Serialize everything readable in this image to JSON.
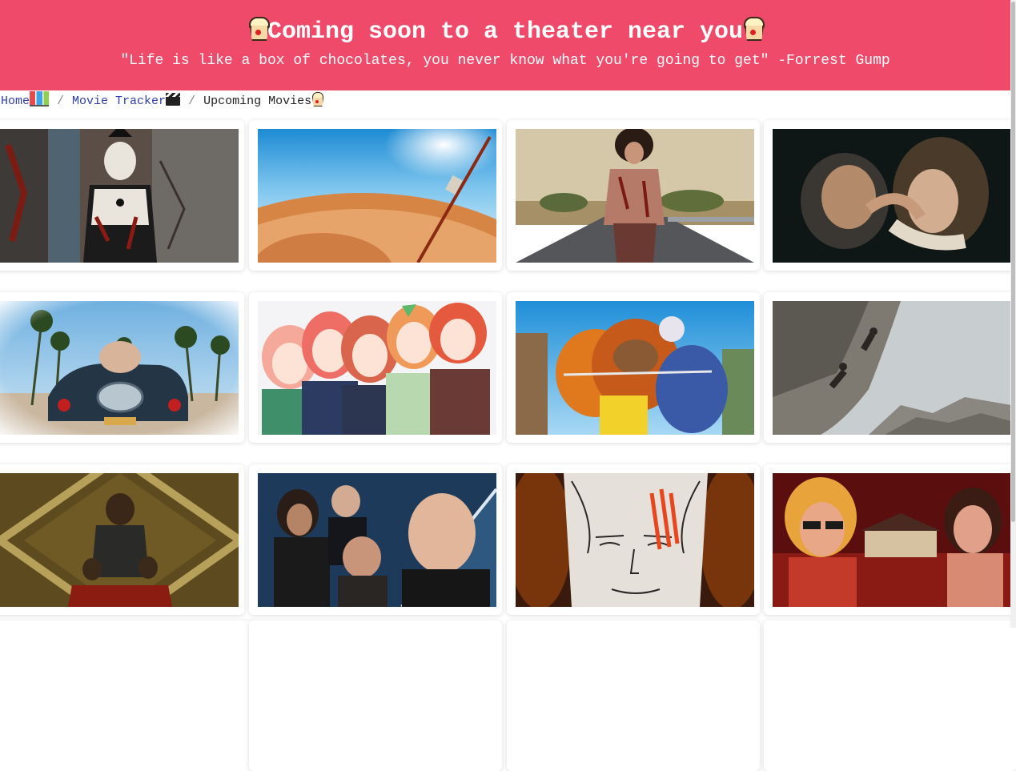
{
  "header": {
    "title": "Coming soon to a theater near you",
    "quote": "\"Life is like a box of chocolates, you never know what you're going to get\" -Forrest Gump",
    "background_color": "#f04a6a",
    "icon": "popcorn-icon"
  },
  "breadcrumb": {
    "items": [
      {
        "label": "Home",
        "icon": "books-icon"
      },
      {
        "label": "Movie Tracker",
        "icon": "clapper-board-icon"
      },
      {
        "label": "Upcoming Movies",
        "icon": "popcorn-icon"
      }
    ],
    "separator": "/"
  },
  "movies": [
    {
      "name": "movie-card-horror-clown"
    },
    {
      "name": "movie-card-space-elevator"
    },
    {
      "name": "movie-card-bloody-road"
    },
    {
      "name": "movie-card-dark-thriller"
    },
    {
      "name": "movie-card-vintage-car"
    },
    {
      "name": "movie-card-anime-quintuplets"
    },
    {
      "name": "movie-card-samurai-dog"
    },
    {
      "name": "movie-card-cliff-climbers"
    },
    {
      "name": "movie-card-royal-throne"
    },
    {
      "name": "movie-card-action-ensemble"
    },
    {
      "name": "movie-card-manga-scar"
    },
    {
      "name": "movie-card-farmhouse-horror"
    }
  ]
}
